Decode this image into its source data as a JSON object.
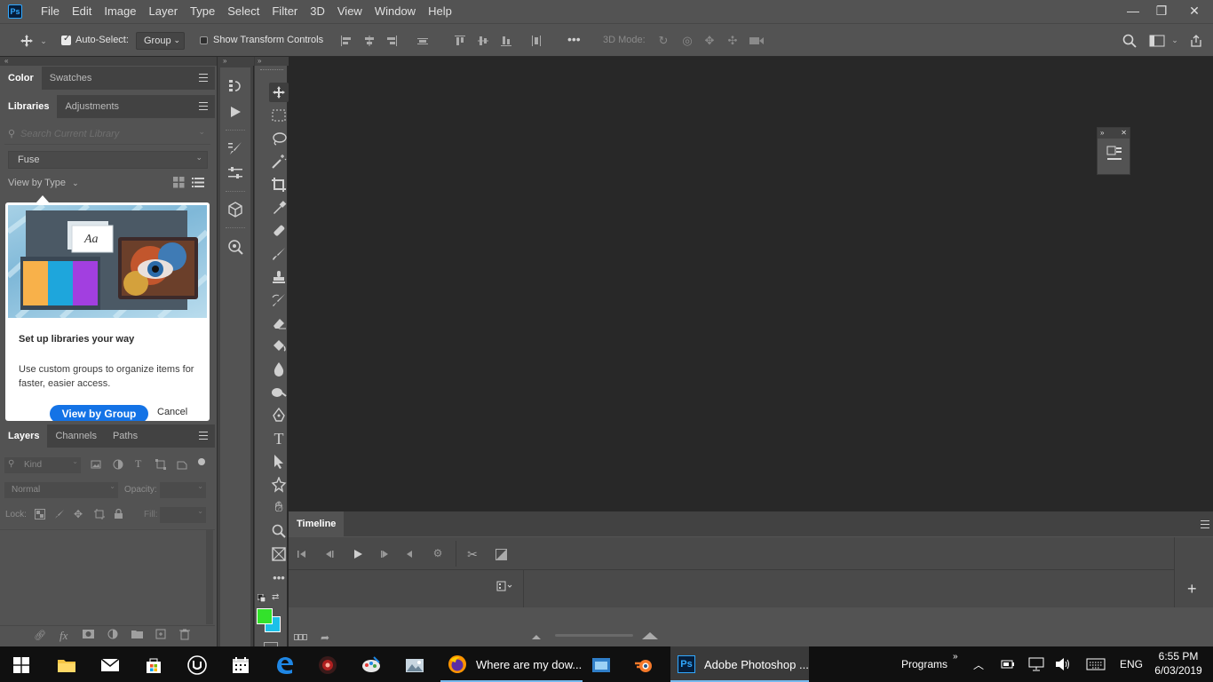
{
  "app": {
    "logo_text": "Ps"
  },
  "menu": [
    "File",
    "Edit",
    "Image",
    "Layer",
    "Type",
    "Select",
    "Filter",
    "3D",
    "View",
    "Window",
    "Help"
  ],
  "window_controls": {
    "minimize": "—",
    "restore": "❐",
    "close": "✕"
  },
  "options_bar": {
    "auto_select_label": "Auto-Select:",
    "auto_select_checked": true,
    "auto_select_value": "Group",
    "transform_controls_label": "Show Transform Controls",
    "transform_controls_checked": false,
    "mode_3d_label": "3D Mode:",
    "more_label": "•••"
  },
  "color_panel": {
    "tabs": [
      "Color",
      "Swatches"
    ],
    "active": "Color"
  },
  "libraries_panel": {
    "tabs": [
      "Libraries",
      "Adjustments"
    ],
    "active": "Libraries",
    "search_placeholder": "Search Current Library",
    "library_selected": "Fuse",
    "view_by_label": "View by Type"
  },
  "popup": {
    "title": "Set up libraries your way",
    "body": "Use custom groups to organize items for faster, easier access.",
    "primary_button": "View by Group",
    "cancel_button": "Cancel",
    "card_text": "Aa"
  },
  "layers_panel": {
    "tabs": [
      "Layers",
      "Channels",
      "Paths"
    ],
    "active": "Layers",
    "filter_label": "Kind",
    "blend_mode": "Normal",
    "opacity_label": "Opacity:",
    "lock_label": "Lock:",
    "fill_label": "Fill:"
  },
  "toolbar": {
    "tools": [
      "move",
      "marquee",
      "lasso",
      "magic-wand",
      "crop",
      "eyedropper",
      "healing",
      "brush",
      "stamp",
      "history-brush",
      "eraser",
      "paint-bucket",
      "blur",
      "dodge",
      "pen",
      "type",
      "path-select",
      "shape",
      "hand",
      "zoom",
      "frame",
      "more"
    ],
    "foreground_color": "#33e22b",
    "background_color": "#1cc0e8",
    "more_label": "•••"
  },
  "timeline": {
    "title": "Timeline",
    "add_label": "+"
  },
  "taskbar": {
    "apps": [
      {
        "name": "firefox",
        "label": "Where are my dow..."
      },
      {
        "name": "photoshop",
        "label": "Adobe Photoshop ..."
      }
    ],
    "programs_label": "Programs",
    "language": "ENG",
    "time": "6:55 PM",
    "date": "6/03/2019"
  },
  "colors": {
    "panel_bg": "#535353",
    "dark_bg": "#282828",
    "accent_blue": "#1473e6",
    "ps_blue": "#31a8ff"
  }
}
